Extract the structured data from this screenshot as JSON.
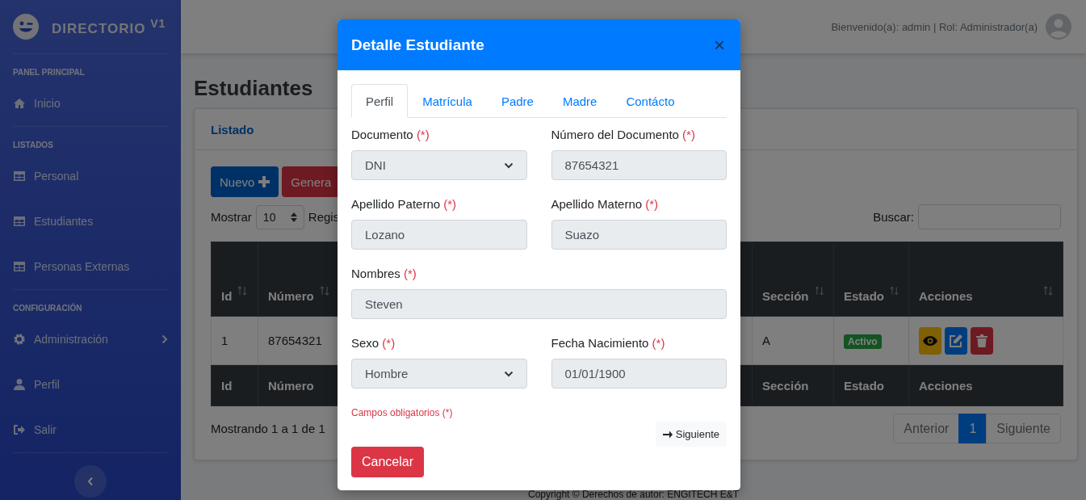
{
  "sidebar": {
    "brand": "DIRECTORIO $^{V1}$",
    "sections": [
      {
        "heading": "PANEL PRINCIPAL",
        "items": [
          {
            "label": "Inicio",
            "kind": "home",
            "submenu": false
          }
        ]
      },
      {
        "heading": "LISTADOS",
        "items": [
          {
            "label": "Personal",
            "kind": "table",
            "submenu": false
          },
          {
            "label": "Estudiantes",
            "kind": "table",
            "submenu": false
          },
          {
            "label": "Personas Externas",
            "kind": "table",
            "submenu": false
          }
        ]
      },
      {
        "heading": "CONFIGURACIÓN",
        "items": [
          {
            "label": "Administración",
            "kind": "settings",
            "submenu": true
          },
          {
            "label": "Perfil",
            "kind": "profile",
            "submenu": false
          },
          {
            "label": "Salir",
            "kind": "logout",
            "submenu": false
          }
        ]
      }
    ]
  },
  "topbar": {
    "user_text": "Bienvenido(a): admin | Rol: Administrador(a)"
  },
  "page": {
    "title": "Estudiantes",
    "card_title": "Listado",
    "buttons": [
      {
        "label": "Nuevo",
        "kind": "primary"
      },
      {
        "label": "Genera",
        "kind": "danger"
      }
    ],
    "length_label": "Mostrar",
    "length_value": "10",
    "length_suffix": "Regis",
    "search_label": "Buscar:",
    "table": {
      "columns_left": [
        {
          "label": "Id"
        },
        {
          "label": "Número"
        }
      ],
      "columns_right": [
        {
          "label": "Sección"
        },
        {
          "label": "Estado"
        },
        {
          "label": "Acciones"
        }
      ],
      "rows": [
        {
          "id": "1",
          "numero": "87654321",
          "seccion": "A",
          "estado": "Activo",
          "actions": [
            {
              "kind": "view"
            },
            {
              "kind": "edit"
            },
            {
              "kind": "delete"
            }
          ]
        }
      ],
      "footer_left": [
        "Id",
        "Número"
      ],
      "footer_right": [
        "Sección",
        "Estado",
        "Acciones"
      ]
    },
    "info": "Mostrando 1 a 1 de 1",
    "pagination": [
      {
        "label": "Anterior",
        "selected": false
      },
      {
        "label": "1",
        "selected": true
      },
      {
        "label": "Siguiente",
        "selected": false
      }
    ]
  },
  "footer": "Copyright © Derechos de autor: ENGITECH E&T",
  "modal": {
    "title": "Detalle Estudiante",
    "close": "×",
    "tabs": [
      {
        "label": "Perfil",
        "selected": true
      },
      {
        "label": "Matrícula",
        "selected": false
      },
      {
        "label": "Padre",
        "selected": false
      },
      {
        "label": "Madre",
        "selected": false
      },
      {
        "label": "Contácto",
        "selected": false
      }
    ],
    "rows": [
      [
        {
          "label": "Documento",
          "required_mark": "(*)",
          "kind": "select",
          "value": "DNI"
        },
        {
          "label": "Número del Documento",
          "required_mark": "(*)",
          "kind": "input",
          "value": "87654321"
        }
      ],
      [
        {
          "label": "Apellido Paterno",
          "required_mark": "(*)",
          "kind": "input",
          "value": "Lozano"
        },
        {
          "label": "Apellido Materno",
          "required_mark": "(*)",
          "kind": "input",
          "value": "Suazo"
        }
      ],
      [
        {
          "label": "Nombres",
          "required_mark": "(*)",
          "kind": "input",
          "value": "Steven"
        }
      ],
      [
        {
          "label": "Sexo",
          "required_mark": "(*)",
          "kind": "select",
          "value": "Hombre"
        },
        {
          "label": "Fecha Nacimiento",
          "required_mark": "(*)",
          "kind": "input",
          "value": "01/01/1900"
        }
      ]
    ],
    "note": "Campos obligatorios (*)",
    "next": "Siguiente",
    "cancel": "Cancelar"
  }
}
